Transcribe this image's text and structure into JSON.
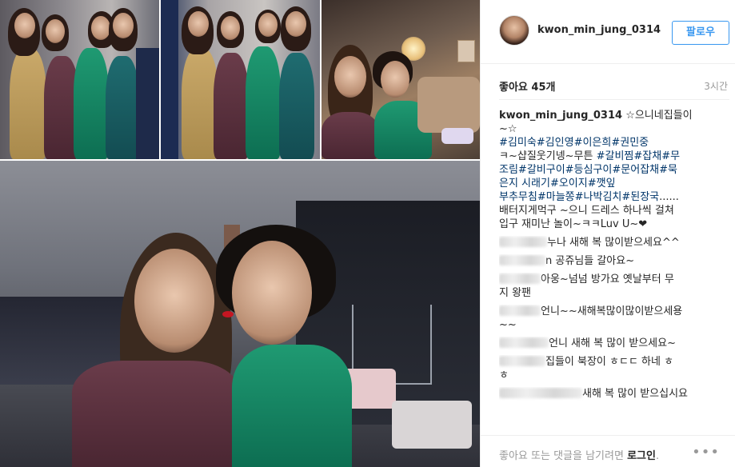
{
  "photos": {
    "p1": "four women in evening dresses",
    "p2": "four women in evening dresses",
    "p3": "women in living room",
    "p4": "two women selfie"
  },
  "post": {
    "username": "kwon_min_jung_0314",
    "follow_label": "팔로우",
    "likes": "좋아요 45개",
    "time": "3시간",
    "caption_user": "kwon_min_jung_0314",
    "caption_lines": [
      [
        {
          "t": " ☆으니네집들이",
          "k": "text"
        }
      ],
      [
        {
          "t": "~☆",
          "k": "text"
        }
      ],
      [
        {
          "t": "#김미숙",
          "k": "tag"
        },
        {
          "t": "#김인영",
          "k": "tag"
        },
        {
          "t": "#이은희",
          "k": "tag"
        },
        {
          "t": "#권민중",
          "k": "tag"
        }
      ],
      [
        {
          "t": "ㅋ~샵질웃기넹~무튼 ",
          "k": "text"
        },
        {
          "t": "#갈비찜",
          "k": "tag"
        },
        {
          "t": "#잡채",
          "k": "tag"
        },
        {
          "t": "#무",
          "k": "tag"
        }
      ],
      [
        {
          "t": "조림",
          "k": "tag"
        },
        {
          "t": "#갈비구이",
          "k": "tag"
        },
        {
          "t": "#등심구이",
          "k": "tag"
        },
        {
          "t": "#문어잡채",
          "k": "tag"
        },
        {
          "t": "#묵",
          "k": "tag"
        }
      ],
      [
        {
          "t": "은지 시래기",
          "k": "tag"
        },
        {
          "t": "#오이지",
          "k": "tag"
        },
        {
          "t": "#깻잎",
          "k": "tag"
        }
      ],
      [
        {
          "t": "부추무침",
          "k": "tag"
        },
        {
          "t": "#마늘쫑",
          "k": "tag"
        },
        {
          "t": "#나박김치",
          "k": "tag"
        },
        {
          "t": "#된장국",
          "k": "tag"
        },
        {
          "t": "......",
          "k": "text"
        }
      ],
      [
        {
          "t": "배터지게먹구 ~으니 드레스 하나씩 걸쳐",
          "k": "text"
        }
      ],
      [
        {
          "t": "입구 재미난 놀이~ㅋㅋLuv U~❤",
          "k": "text"
        }
      ]
    ],
    "comments": [
      {
        "blur": 60,
        "text": "누나 새해 복 많이받으세요^^"
      },
      {
        "blur": 58,
        "text": "n 공쥬님들 갈아요~"
      },
      {
        "blur": 52,
        "text": "아웅~넘넘 방가요  옛날부터 무"
      },
      {
        "blur": 0,
        "text": "지 왕팬 "
      },
      {
        "blur": 52,
        "text": "언니~~새해복많이많이받으세용"
      },
      {
        "blur": 0,
        "text": "~~"
      },
      {
        "blur": 62,
        "text": "언니 새해 복 많이 받으세요~"
      },
      {
        "blur": 58,
        "text": "집들이 북장이 ㅎㄷㄷ 하네 ㅎ"
      },
      {
        "blur": 0,
        "text": "ㅎ"
      },
      {
        "blur": 104,
        "text": "새해 복 많이 받으십시요"
      }
    ],
    "footer_text": "좋아요 또는 댓글을 남기려면 ",
    "footer_login": "로그인",
    "footer_end": ".",
    "more": "•••"
  }
}
